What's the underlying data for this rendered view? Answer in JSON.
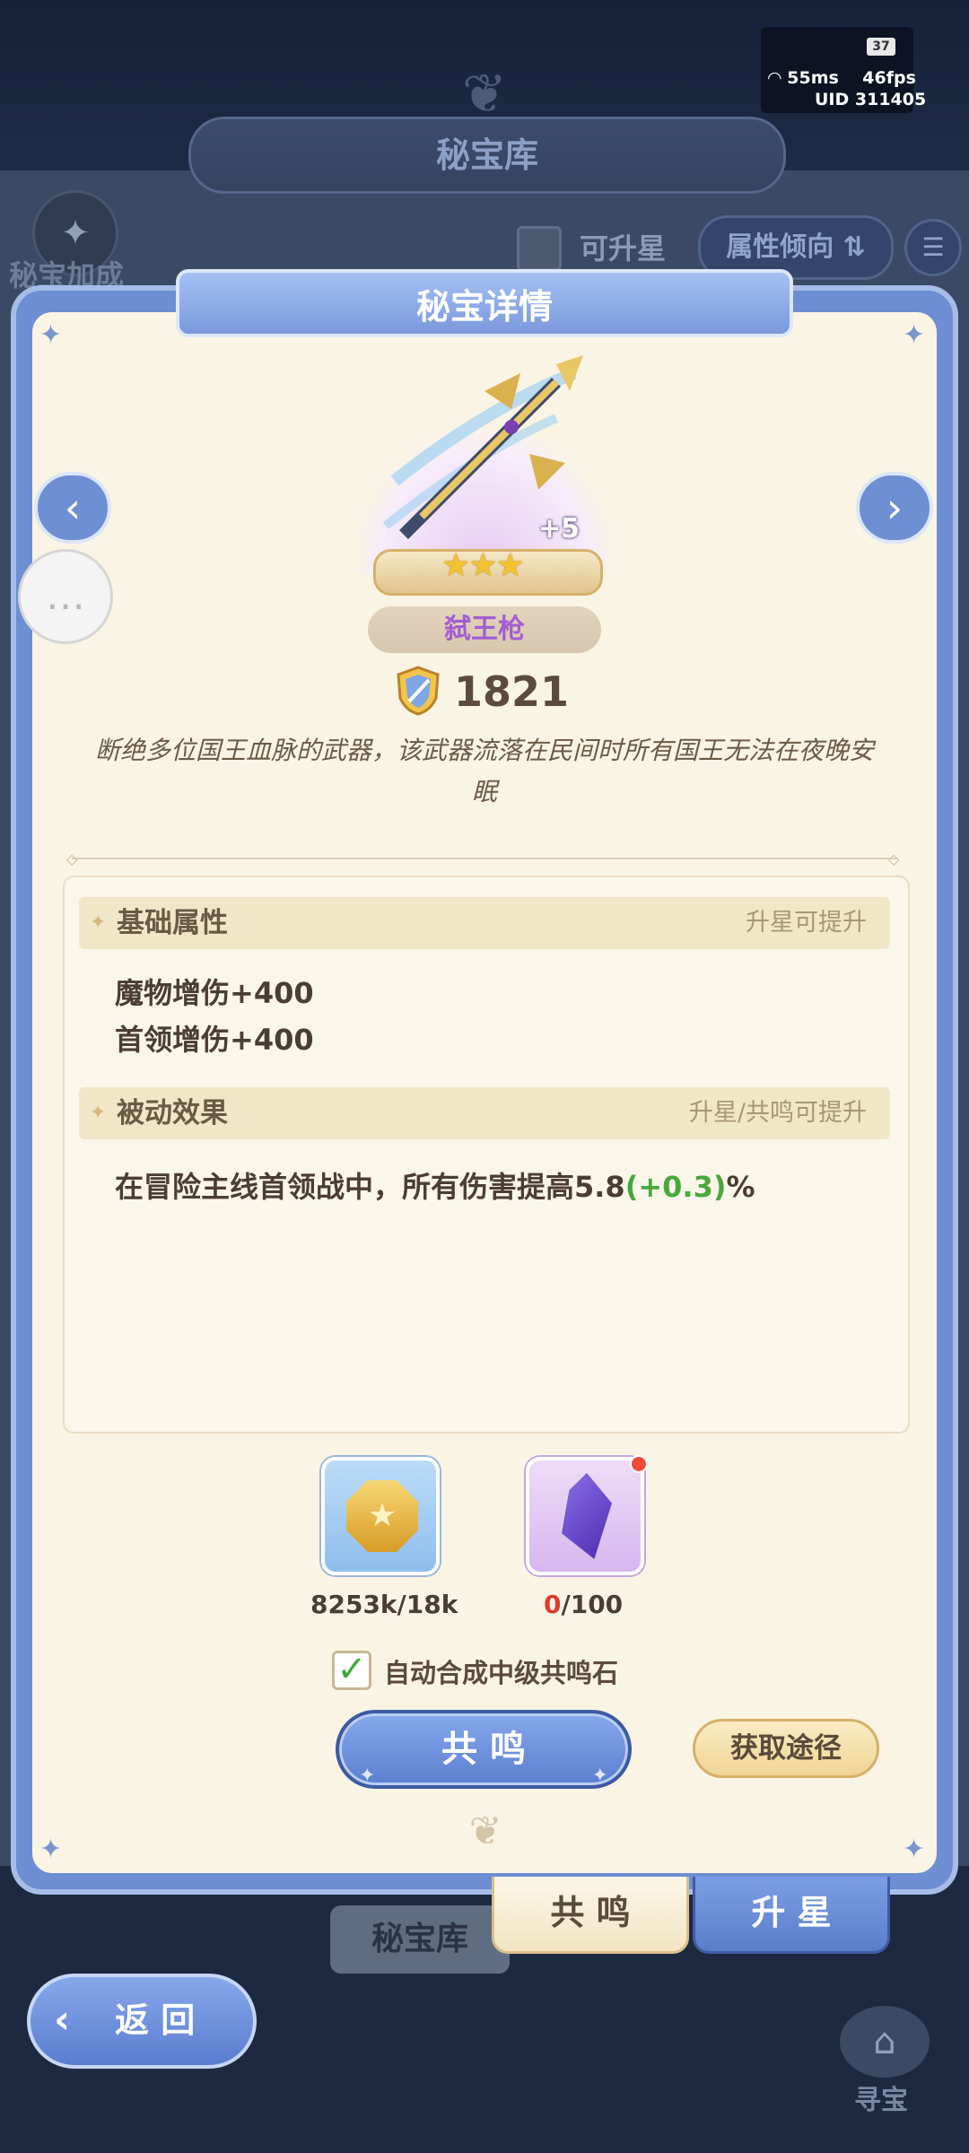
{
  "status_bar": {
    "battery": "37",
    "ping": "55ms",
    "fps": "46fps",
    "uid": "UID 311405"
  },
  "background": {
    "vault_title": "秘宝库",
    "bonus_label": "秘宝加成",
    "upgradable_filter": "可升星",
    "attribute_sort": "属性倾向",
    "sort_icon": "sort-arrows-icon"
  },
  "modal": {
    "title": "秘宝详情",
    "weapon": {
      "name": "弑王枪",
      "enhance_level": "+5",
      "stars": 3,
      "stars_text": "★★★",
      "power": "1821",
      "description": "断绝多位国王血脉的武器，该武器流落在民间时所有国王无法在夜晚安眠"
    },
    "base_attributes": {
      "title": "基础属性",
      "hint": "升星可提升",
      "stats": [
        "魔物增伤+400",
        "首领增伤+400"
      ]
    },
    "passive_effect": {
      "title": "被动效果",
      "hint": "升星/共鸣可提升",
      "text_prefix": "在冒险主线首领战中，所有伤害提高5.8",
      "bonus": "(+0.3)",
      "suffix": "%"
    },
    "materials": [
      {
        "icon": "gold-coin-icon",
        "count": "8253k/18k"
      },
      {
        "icon": "purple-crystal-icon",
        "count_have": "0",
        "count_need": "/100"
      }
    ],
    "auto_compose": {
      "checked": true,
      "label": "自动合成中级共鸣石"
    },
    "resonate_button": "共 鸣",
    "obtain_button": "获取途径"
  },
  "tabs": {
    "vault": "秘宝库",
    "resonate": "共 鸣",
    "star_up": "升 星"
  },
  "back_button": "返 回",
  "treasure_label": "寻宝",
  "colors": {
    "accent_blue": "#6f8fd3",
    "panel_cream": "#faf4e4",
    "bonus_green": "#4aa83c",
    "alert_red": "#e03a2c",
    "name_purple": "#a35fd0"
  }
}
